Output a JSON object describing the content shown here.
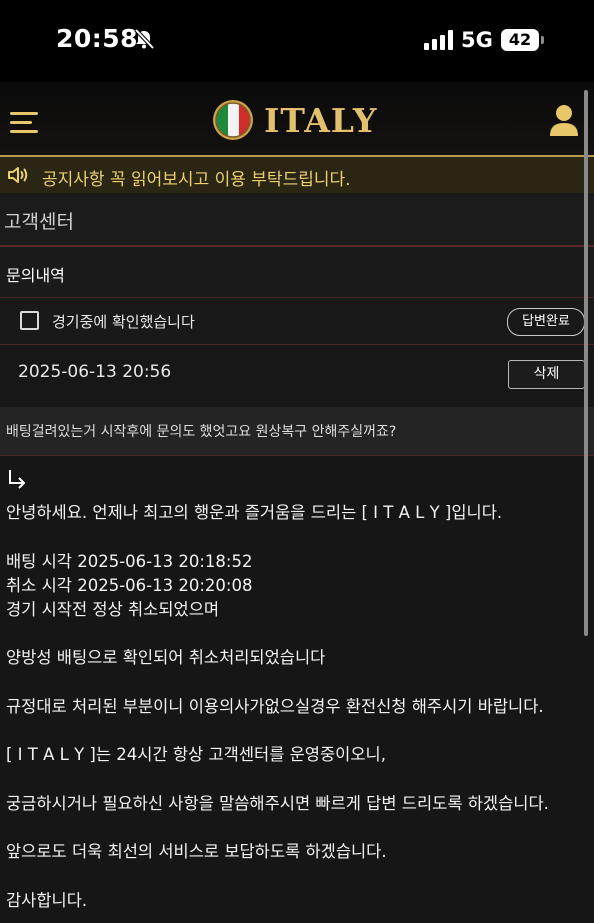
{
  "status_bar": {
    "time": "20:58",
    "network": "5G",
    "battery": "42"
  },
  "header": {
    "logo_text": "ITALY",
    "accent_color": "#e3c06d"
  },
  "notice": {
    "text": "공지사항 꼭 읽어보시고 이용 부탁드립니다."
  },
  "page": {
    "title": "고객센터",
    "subtitle": "문의내역"
  },
  "inquiry": {
    "subject": "경기중에 확인했습니다",
    "status_badge": "답변완료",
    "datetime": "2025-06-13 20:56",
    "delete_label": "삭제",
    "question": "배팅걸려있는거 시작후에 문의도 했엇고요 원상복구 안해주실꺼죠?"
  },
  "answer": {
    "lines": [
      "안녕하세요. 언제나 최고의 행운과 즐거움을 드리는 [ I T A L Y ]입니다.",
      "배팅 시각 2025-06-13 20:18:52",
      "취소 시각 2025-06-13 20:20:08",
      "경기 시작전 정상 취소되었으며",
      "양방성 배팅으로 확인되어 취소처리되었습니다",
      "규정대로 처리된 부분이니 이용의사가없으실경우 환전신청 해주시기 바랍니다.",
      "[ I T A L Y ]는 24시간 항상 고객센터를 운영중이오니,",
      "궁금하시거나 필요하신 사항을 말씀해주시면 빠르게 답변 드리도록 하겠습니다.",
      "앞으로도 더욱 최선의 서비스로 보답하도록 하겠습니다.",
      "감사합니다."
    ]
  }
}
